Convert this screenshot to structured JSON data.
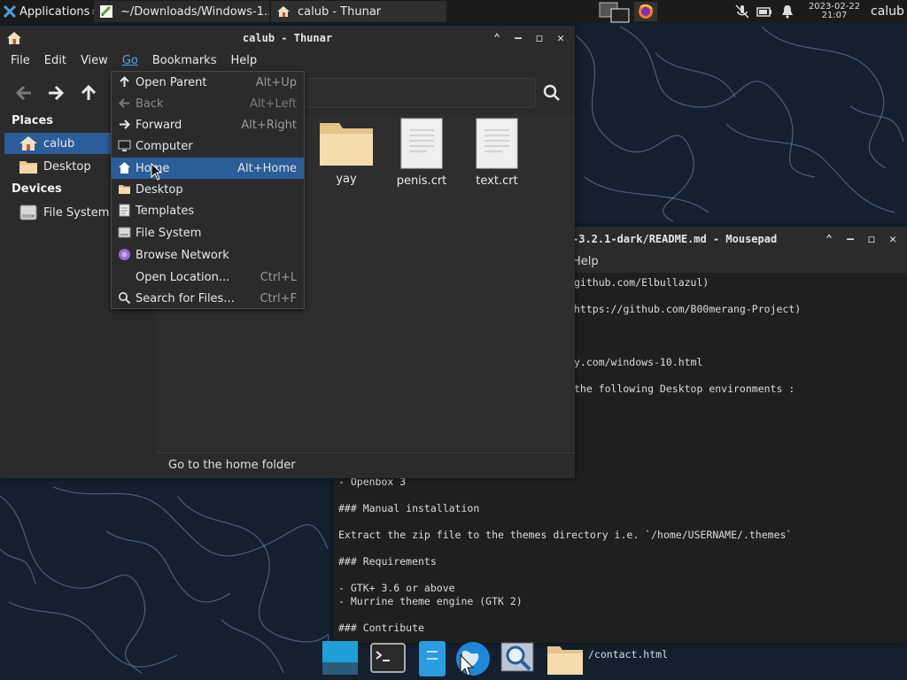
{
  "panel": {
    "applications_label": "Applications",
    "tasks": [
      {
        "title": "~/Downloads/Windows-1..."
      },
      {
        "title": "calub - Thunar"
      }
    ],
    "clock_date": "2023-02-22",
    "clock_time": "21:07",
    "user": "calub"
  },
  "thunar": {
    "title": "calub - Thunar",
    "menu": [
      "File",
      "Edit",
      "View",
      "Go",
      "Bookmarks",
      "Help"
    ],
    "sidebar": {
      "places_header": "Places",
      "places": [
        {
          "label": "calub",
          "icon": "home-icon"
        },
        {
          "label": "Desktop",
          "icon": "folder-icon"
        }
      ],
      "devices_header": "Devices",
      "devices": [
        {
          "label": "File System",
          "icon": "drive-icon"
        }
      ]
    },
    "files": [
      {
        "name": "yay",
        "icon": "folder-icon"
      },
      {
        "name": "penis.crt",
        "icon": "document-icon"
      },
      {
        "name": "text.crt",
        "icon": "document-icon"
      }
    ],
    "status": "Go to the home folder"
  },
  "go_menu": {
    "items": [
      {
        "label": "Open Parent",
        "accel": "Alt+Up",
        "icon": "arrow-up-icon",
        "disabled": false
      },
      {
        "label": "Back",
        "accel": "Alt+Left",
        "icon": "arrow-left-icon",
        "disabled": true
      },
      {
        "label": "Forward",
        "accel": "Alt+Right",
        "icon": "arrow-right-icon",
        "disabled": false
      },
      {
        "label": "Computer",
        "accel": "",
        "icon": "computer-icon",
        "disabled": false
      },
      {
        "label": "Home",
        "accel": "Alt+Home",
        "icon": "home-icon",
        "disabled": false,
        "highlighted": true
      },
      {
        "label": "Desktop",
        "accel": "",
        "icon": "folder-icon",
        "disabled": false
      },
      {
        "label": "Templates",
        "accel": "",
        "icon": "templates-icon",
        "disabled": false
      },
      {
        "label": "File System",
        "accel": "",
        "icon": "drive-icon",
        "disabled": false
      },
      {
        "label": "Browse Network",
        "accel": "",
        "icon": "network-icon",
        "disabled": false
      },
      {
        "label": "Open Location...",
        "accel": "Ctrl+L",
        "icon": "",
        "disabled": false
      },
      {
        "label": "Search for Files...",
        "accel": "Ctrl+F",
        "icon": "search-icon",
        "disabled": false
      }
    ]
  },
  "mousepad": {
    "title": "-3.2.1-dark/README.md - Mousepad",
    "menu_help": "Help",
    "lines": [
      "github.com/Elbullazul)",
      "https://github.com/B00merang-Project)",
      "y.com/windows-10.html",
      "the following Desktop environments :",
      "- Openbox 3",
      "### Manual installation",
      "Extract the zip file to the themes directory i.e. `/home/USERNAME/.themes`",
      "### Requirements",
      "- GTK+ 3.6 or above",
      "- Murrine theme engine (GTK 2)",
      "### Contribute",
      "/contact.html"
    ]
  },
  "colors": {
    "accent": "#2a5d9a",
    "menu_active": "#5aa0e8",
    "folder": "#f0d9a8",
    "wallpaper": "#15202e"
  }
}
